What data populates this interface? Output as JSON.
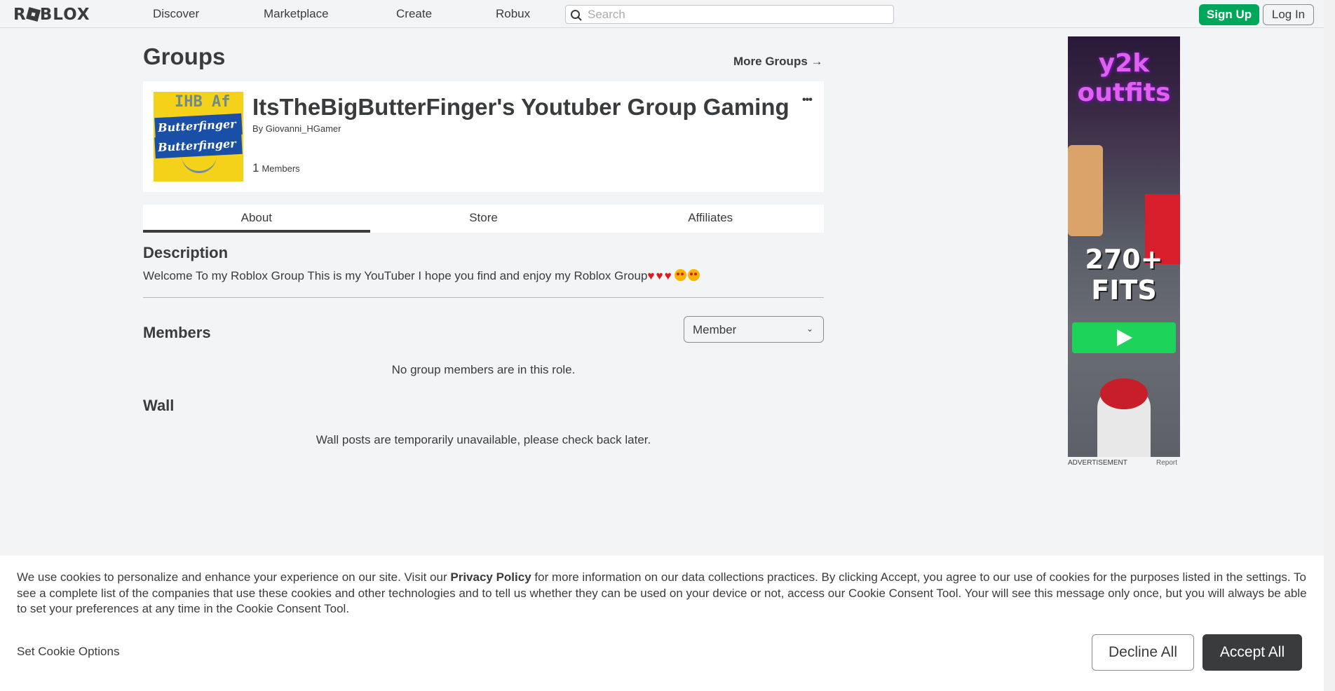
{
  "nav": {
    "logo": "ROBLOX",
    "links": [
      "Discover",
      "Marketplace",
      "Create",
      "Robux"
    ],
    "search_placeholder": "Search",
    "signup": "Sign Up",
    "login": "Log In"
  },
  "page": {
    "title": "Groups",
    "more_groups": "More Groups →"
  },
  "group": {
    "name": "ItsTheBigButterFinger's Youtuber Group Gaming",
    "by_prefix": "By",
    "owner": "Giovanni_HGamer",
    "members_count": "1",
    "members_label": "Members",
    "more_menu": "•••",
    "thumbnail_text": "Butterfinger",
    "thumbnail_scrawl": "IHB Af"
  },
  "tabs": [
    "About",
    "Store",
    "Affiliates"
  ],
  "about": {
    "description_heading": "Description",
    "description_text": "Welcome To my Roblox Group This is my YouTuber I hope you find and enjoy my Roblox Group",
    "description_hearts": "♥♥♥",
    "members_heading": "Members",
    "role_selected": "Member",
    "members_empty": "No group members are in this role.",
    "wall_heading": "Wall",
    "wall_empty": "Wall posts are temporarily unavailable, please check back later."
  },
  "ad": {
    "brand": "y2k outfits",
    "headline": "270+ FITS",
    "label": "ADVERTISEMENT",
    "report": "Report"
  },
  "cookie": {
    "text_before": "We use cookies to personalize and enhance your experience on our site. Visit our ",
    "policy_link": "Privacy Policy",
    "text_after": " for more information on our data collections practices. By clicking Accept, you agree to our use of cookies for the purposes listed in the settings. To see a complete list of the companies that use these cookies and other technologies and to tell us whether they can be used on your device or not, access our Cookie Consent Tool. Your will see this message only once, but you will always be able to set your preferences at any time in the Cookie Consent Tool.",
    "set_options": "Set Cookie Options",
    "decline": "Decline All",
    "accept": "Accept All"
  },
  "colors": {
    "signup_green": "#00a65a",
    "accept_dark": "#393b3d",
    "page_bg": "#f2f4f5"
  }
}
